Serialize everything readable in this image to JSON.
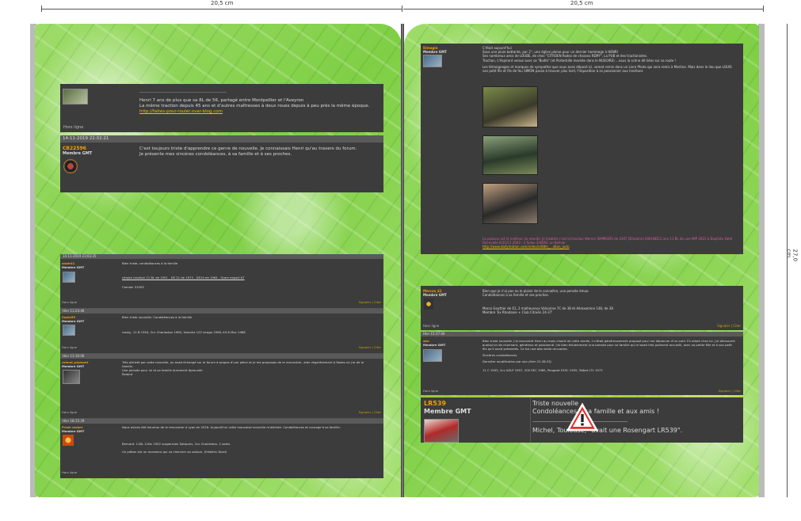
{
  "dimensions": {
    "left_width": "20,5 cm",
    "right_width": "20,5 cm",
    "height": "27,0 cm"
  },
  "colors": {
    "page_green": "#8fd65a",
    "panel_bg": "#3c3c3c",
    "username": "#f0a000",
    "link": "#f0c000",
    "warning_red": "#e0322c"
  },
  "left": {
    "post_top": {
      "message_line1": "Henri 7 ans de plus que sa 8L de 56, partagé entre Montpellier et l'Aveyron",
      "message_line2": "La même traction depuis 45 ans et d'autres maîtresses à deux roues depuis à peu près la même époque.",
      "link": "http://faites-pour-rouler.over-blog.com",
      "signature": "Hors ligne"
    },
    "post_cb": {
      "date": "14-11-2019 22:02:21",
      "user": "CB22596",
      "rank": "Membre GMT",
      "message_line1": "C'est toujours triste d'apprendre ce genre de nouvelle. Je connaissais Henri qu'au travers du forum.",
      "message_line2": "Je présente mes sincères condoléances, à sa famille et à ses proches."
    },
    "thread": [
      {
        "date": "14-11-2019 23:03:35",
        "user": "aladr41",
        "rank": "Membre GMT",
        "msg": "Bien triste, condoléances à la famille",
        "msg2": "citroen traction 11 BL de 1951  -  DS 21 de 1973  -  DS19 de 1964 - Scam export 67",
        "msg3": "Camion 3100S",
        "sig": "Hors ligne",
        "right": "Signaler | Citer"
      },
      {
        "date": "Hier 11:24:46",
        "user": "Sepie59",
        "rank": "Membre GMT",
        "msg": "Bien triste nouvelle. Condoléances à la famille.",
        "msg2": "rosley, 11 B 1954, 2cv Charleston 1985, Yamaha 125 virago 1998, Kit 6 Mac 1988",
        "msg3": "",
        "sig": "Hors ligne",
        "right": "Signaler | Citer"
      },
      {
        "date": "Hier 13:16:06",
        "user": "roland_plamont",
        "rank": "Membre GMT",
        "msg": "Très attristé par cette nouvelle, on avait échangé sur le forum à propos d'une pièce et je me proposais de le rencontrer, aller régulièrement à Rodez où j'ai de la famille.",
        "msg2": "Une pensée pour lui et sa famille durement éprouvée",
        "msg3": "Roland",
        "sig": "Hors ligne",
        "right": "Signaler | Citer"
      },
      {
        "date": "Hier 18:15:39",
        "user": "Fresh maker",
        "rank": "Membre GMT",
        "msg": "Nous avions été heureux de le rencontrer à Lyon en 2016. Aujourd'hui cette mauvaise nouvelle m'attriste. Condoléances et courage à sa famille.",
        "msg2": "Bernard: 11BL 11Nc 1952 suspension Sotiparis, 2cv Charleston, 2 solex.",
        "msg3": "Un piéton est un monsieur qui va chercher sa voiture. (Frédéric Dard)",
        "sig": "Hors ligne",
        "right": "Signaler | Citer"
      }
    ]
  },
  "right": {
    "post_top": {
      "user": "Dimagin",
      "rank": "Membre GMT",
      "title": "C'était aujourd'hui",
      "line1": "Sous une pluie battante, par 2°, une église pleine pour un dernier hommage à HENRI",
      "line2": "Ses nombreux amis de LOUBE, de chez \"CITROEN Rodez de chassez REMY\", La PUB et des tractionistes.",
      "line3": "Traction, L'Aspirant venue avec sa \"Bodhi\" (et Porterbille montée dans le NUSOIRE) ...nous la scène dit liées sur sa route !",
      "line4": "Les témoignages et marques de sympathie que vous avez déposé ici, seront remis dans un Livre Photo qui sera remis à Martine. Mais dans le lieu que LOUIS son petit fils et fils de feu SIMON passe à trouver plus tard, l'imposition à se passionner aux tractions",
      "footer": "La passion est le meilleur du monde. Je tradiste c'est la traction Werner SIMMGERI de 1947 [Dimaine] 4001ND11 une 11 BL de une IMP 2023 à Baptiste Vatel Decevalle 6/11/11 2003 - 2 Solex 3300SC un Bolivar",
      "footer_link": "http://www.dailymotion.com/video/x4t8m_...idion_auto"
    },
    "post_mid": {
      "user": "Marcos_61",
      "rank": "Membre GMT",
      "msg": "Bien que je n'ai pas eu le plaisir de le connaître, une pensée émue.",
      "msg_b": "Condoléances à sa famille et ses proches.",
      "msg2": "Marco Gouttier de 61, 2 malheureux Volvorine 7C de 38 et Aéroxomine 148, de 38",
      "msg3": "Membre 'Ex Rhodanie + Club Citroën 24-37'",
      "sig": "Hors ligne",
      "right": "Signaler | Citer"
    },
    "post_low": {
      "date": "Hier 15:37:40",
      "user": "sbo",
      "rank": "Membre GMT",
      "msg": "Bien triste nouvelle. J'ai rencontré Henri au mois d'août de cette année, il s'était généreusement proposé pour me dépanner d'un outil. En allant chez lui, j'ai découvert quelqu'un de charmant, généreux et passionné. J'ai bien évidemment une pensée pour sa famille qui m'avait très poliment accueilli, avec sa petite fille et à son petit fils qu'il avait présentés. Ce fut une bien belle rencontre.",
      "msg2": "Sincères condoléances",
      "msg3": "Dernière modification par sbo (Hier 21:38:23)",
      "msg4": "11 C 1953, 2cv AZLP 1957, 200 SEC 1985, Peugeot 535C 1955, Talbot LT1 1973",
      "sig": "Hors ligne",
      "right": "Signaler | Citer"
    },
    "post_big": {
      "user": "LR539",
      "rank": "Membre GMT",
      "line1": "Triste nouvelle",
      "line2": "Condoléances à sa famille et aux amis !",
      "line3": "Michel, Toulouse, \"avait une Rosengart LR539\"."
    }
  }
}
